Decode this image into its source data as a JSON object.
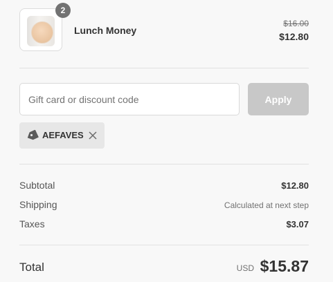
{
  "product": {
    "name": "Lunch Money",
    "quantity": "2",
    "original_price": "$16.00",
    "sale_price": "$12.80"
  },
  "discount": {
    "placeholder": "Gift card or discount code",
    "value": "",
    "apply_label": "Apply",
    "applied_code": "AEFAVES"
  },
  "summary": {
    "subtotal_label": "Subtotal",
    "subtotal_value": "$12.80",
    "shipping_label": "Shipping",
    "shipping_value": "Calculated at next step",
    "taxes_label": "Taxes",
    "taxes_value": "$3.07"
  },
  "total": {
    "label": "Total",
    "currency": "USD",
    "value": "$15.87"
  },
  "icons": {
    "tag": "tag-icon",
    "remove": "close-icon"
  },
  "colors": {
    "badge": "#727272",
    "apply_disabled": "#c8c8c8",
    "chip": "#e7e7e7"
  }
}
